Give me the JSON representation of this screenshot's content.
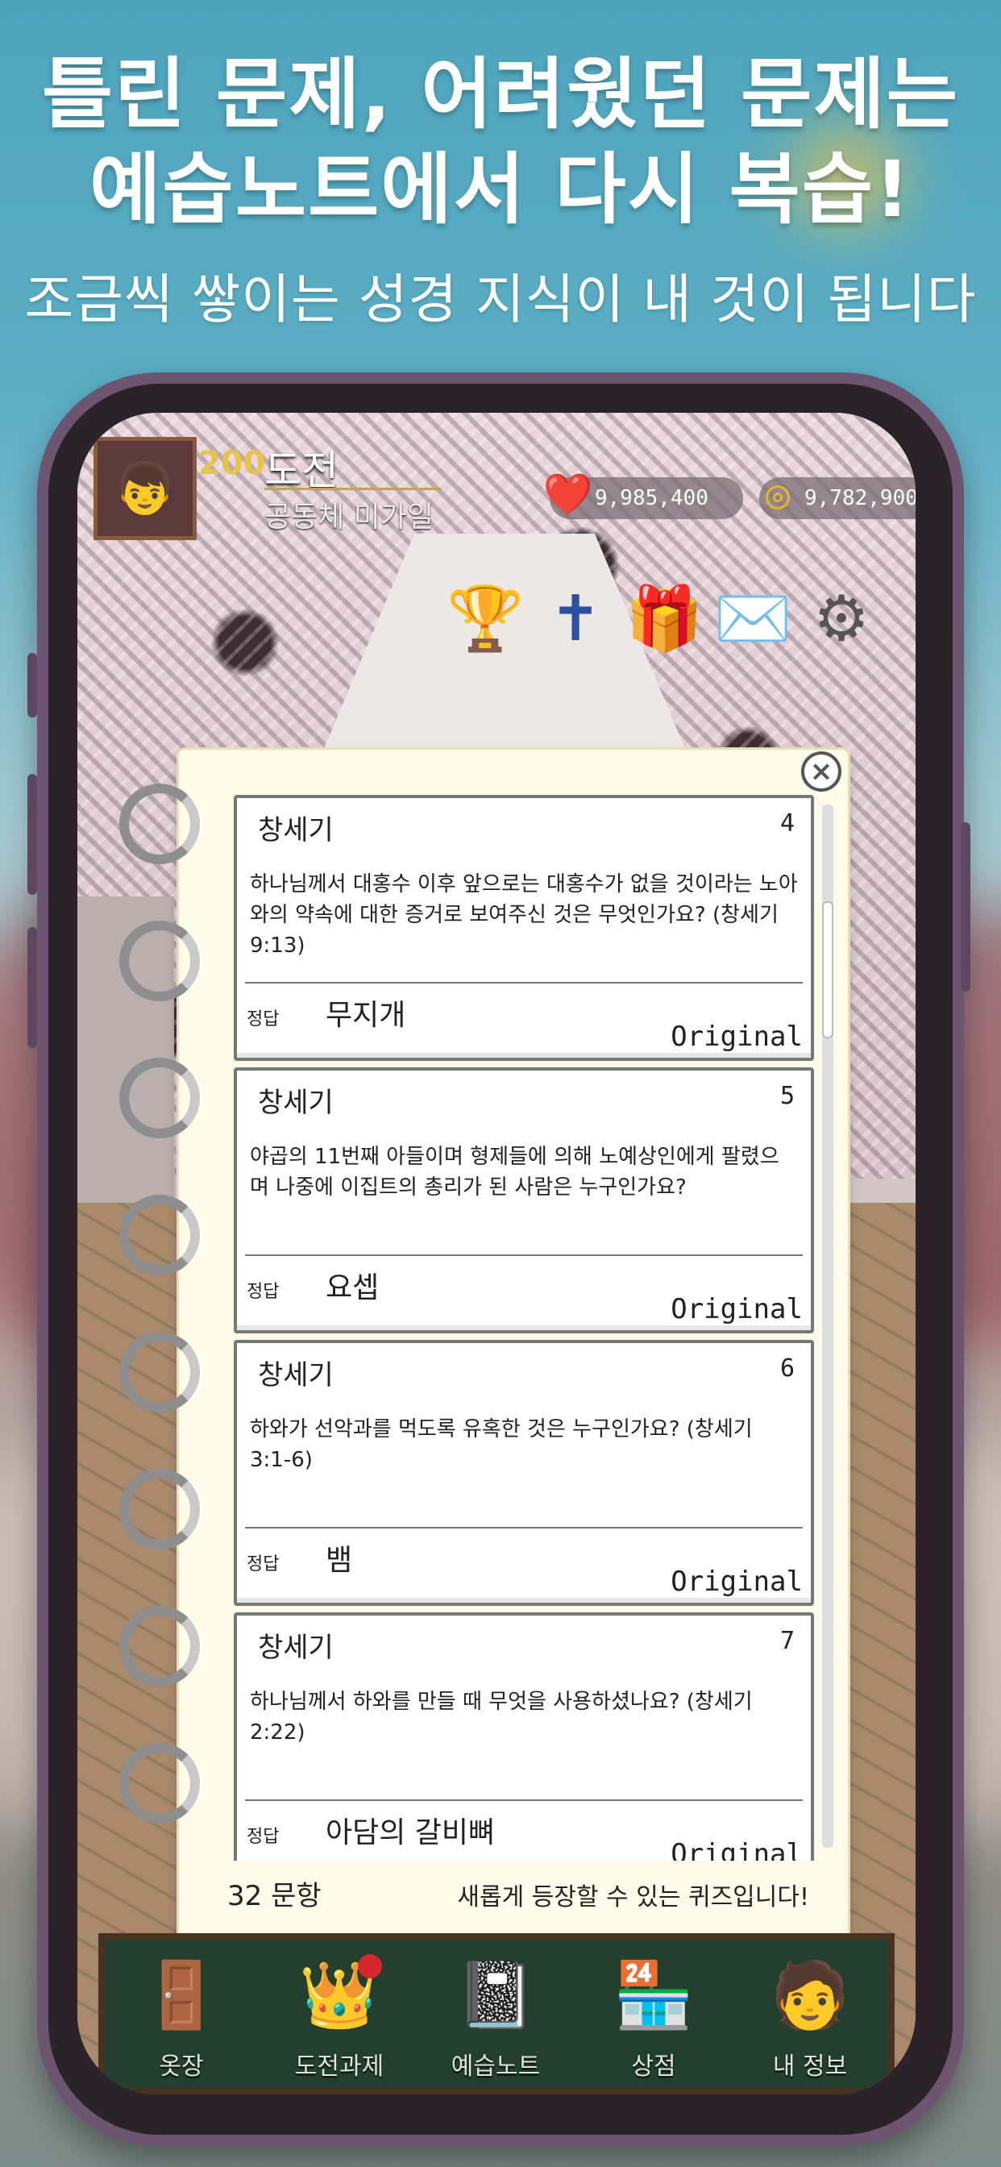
{
  "hero": {
    "title_line1": "틀린 문제, 어려웠던 문제는",
    "title_line2": "예습노트에서 다시 복습!",
    "subtitle": "조금씩 쌓이는 성경 지식이 내 것이 됩니다"
  },
  "hud": {
    "level": "200",
    "name": "도전",
    "title": "공동체 미가일",
    "hearts": "9,985,400",
    "coins": "9,782,900",
    "icons": [
      "trophy-icon",
      "banner-icon",
      "gift-icon",
      "mail-icon",
      "gear-icon"
    ]
  },
  "notebook": {
    "cards": [
      {
        "book": "창세기",
        "number": "4",
        "question": "하나님께서 대홍수 이후 앞으로는 대홍수가 없을 것이라는 노아와의 약속에 대한 증거로 보여주신 것은 무엇인가요? (창세기 9:13)",
        "answer_label": "정답",
        "answer": "무지개",
        "source": "Original"
      },
      {
        "book": "창세기",
        "number": "5",
        "question": "야곱의 11번째 아들이며 형제들에 의해 노예상인에게 팔렸으며 나중에 이집트의 총리가 된 사람은 누구인가요?",
        "answer_label": "정답",
        "answer": "요셉",
        "source": "Original"
      },
      {
        "book": "창세기",
        "number": "6",
        "question": "하와가 선악과를 먹도록 유혹한 것은 누구인가요? (창세기 3:1-6)",
        "answer_label": "정답",
        "answer": "뱀",
        "source": "Original"
      },
      {
        "book": "창세기",
        "number": "7",
        "question": "하나님께서 하와를 만들 때 무엇을 사용하셨나요? (창세기 2:22)",
        "answer_label": "정답",
        "answer": "아담의 갈비뼈",
        "source": "Original"
      }
    ],
    "count": "32 문항",
    "hint": "새롭게 등장할 수 있는 퀴즈입니다!"
  },
  "nav": {
    "items": [
      {
        "label": "옷장",
        "icon": "wardrobe-icon"
      },
      {
        "label": "도전과제",
        "icon": "crown-icon"
      },
      {
        "label": "예습노트",
        "icon": "notebook-icon"
      },
      {
        "label": "상점",
        "icon": "store-icon"
      },
      {
        "label": "내 정보",
        "icon": "profile-icon"
      }
    ]
  },
  "colors": {
    "accent": "#caa24b",
    "nav_bg": "#23402f",
    "phone_frame": "#6e556f"
  }
}
